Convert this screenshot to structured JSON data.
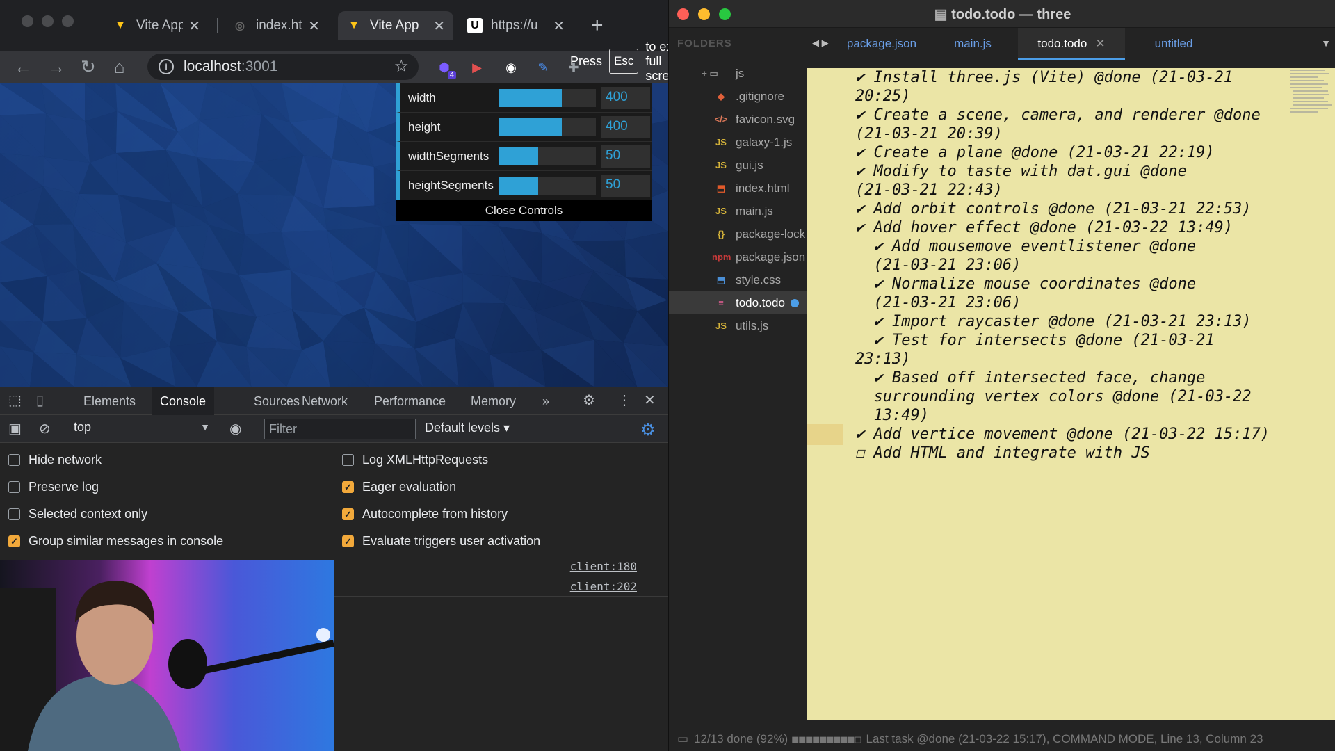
{
  "browser": {
    "tabs": [
      {
        "label": "Vite App",
        "icon": "vite-icon"
      },
      {
        "label": "index.htm",
        "icon": "globe-icon"
      },
      {
        "label": "Vite App",
        "icon": "vite-icon"
      },
      {
        "label": "https://u",
        "icon": "u-logo-icon"
      }
    ],
    "url_host": "localhost",
    "url_port": ":3001",
    "extension_badge": "4",
    "fullscreen_notice": {
      "before": "Press",
      "key": "Esc",
      "after": "to exit full screen"
    }
  },
  "gui": {
    "rows": [
      {
        "name": "width",
        "value": "400",
        "fill": 0.65
      },
      {
        "name": "height",
        "value": "400",
        "fill": 0.65
      },
      {
        "name": "widthSegments",
        "value": "50",
        "fill": 0.4
      },
      {
        "name": "heightSegments",
        "value": "50",
        "fill": 0.4
      }
    ],
    "close_label": "Close Controls"
  },
  "devtools": {
    "tabs": [
      "Elements",
      "Console",
      "Sources",
      "Network",
      "Performance",
      "Memory"
    ],
    "more": "»",
    "context": "top",
    "filter_placeholder": "Filter",
    "levels": "Default levels ▾",
    "options": [
      {
        "label": "Hide network",
        "checked": false
      },
      {
        "label": "Log XMLHttpRequests",
        "checked": false
      },
      {
        "label": "Preserve log",
        "checked": false
      },
      {
        "label": "Eager evaluation",
        "checked": true
      },
      {
        "label": "Selected context only",
        "checked": false
      },
      {
        "label": "Autocomplete from history",
        "checked": true
      },
      {
        "label": "Group similar messages in console",
        "checked": true
      },
      {
        "label": "Evaluate triggers user activation",
        "checked": true
      }
    ],
    "messages": [
      "client:180",
      "client:202"
    ]
  },
  "sublime": {
    "title": "todo.todo — three",
    "folders_header": "FOLDERS",
    "files": [
      {
        "name": "js",
        "type": "folder"
      },
      {
        "name": ".gitignore",
        "type": "git"
      },
      {
        "name": "favicon.svg",
        "type": "svg"
      },
      {
        "name": "galaxy-1.js",
        "type": "js"
      },
      {
        "name": "gui.js",
        "type": "js"
      },
      {
        "name": "index.html",
        "type": "html"
      },
      {
        "name": "main.js",
        "type": "js"
      },
      {
        "name": "package-lock",
        "type": "json"
      },
      {
        "name": "package.json",
        "type": "npm"
      },
      {
        "name": "style.css",
        "type": "css"
      },
      {
        "name": "todo.todo",
        "type": "todo"
      },
      {
        "name": "utils.js",
        "type": "js"
      }
    ],
    "tabs": [
      "package.json",
      "main.js",
      "todo.todo",
      "untitled"
    ],
    "todo_lines": [
      "✔ Install three.js (Vite) @done (21-03-21\n20:25)",
      "✔ Create a scene, camera, and renderer @done\n(21-03-21 20:39)",
      "✔ Create a plane @done (21-03-21 22:19)",
      "✔ Modify to taste with dat.gui @done\n(21-03-21 22:43)",
      "✔ Add orbit controls @done (21-03-21 22:53)",
      "✔ Add hover effect @done (21-03-22 13:49)",
      "  ✔ Add mousemove eventlistener @done\n  (21-03-21 23:06)",
      "  ✔ Normalize mouse coordinates @done\n  (21-03-21 23:06)",
      "  ✔ Import raycaster @done (21-03-21 23:13)",
      "  ✔ Test for intersects @done (21-03-21 23:13)",
      "  ✔ Based off intersected face, change\n  surrounding vertex colors @done (21-03-22\n  13:49)",
      "✔ Add vertice movement @done (21-03-22 15:17)",
      "☐ Add HTML and integrate with JS"
    ],
    "status_prefix": "12/13 done (92%)",
    "status_blocks": "■■■■■■■■■□",
    "status_suffix": "Last task @done (21-03-22 15:17), COMMAND MODE, Line 13, Column 23"
  }
}
